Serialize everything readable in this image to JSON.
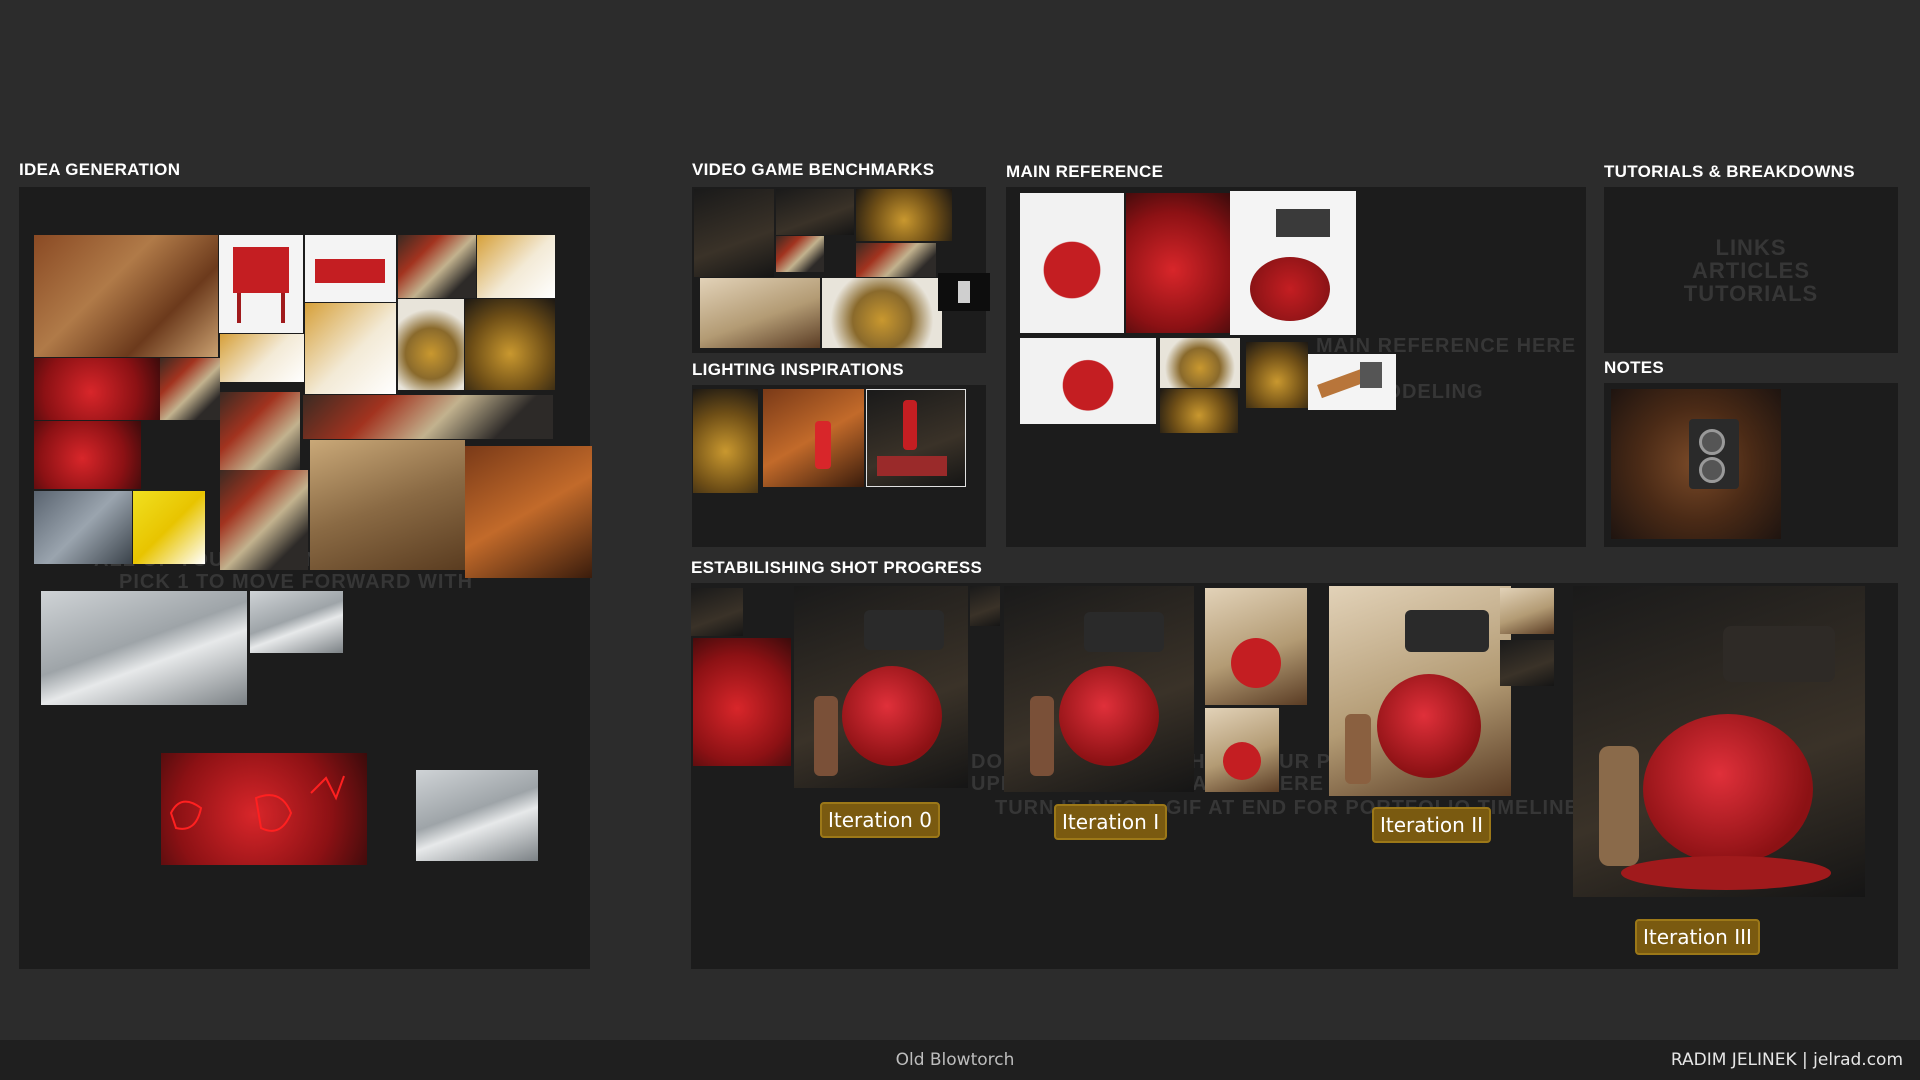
{
  "sections": {
    "idea_generation": "IDEA GENERATION",
    "video_game_benchmarks": "VIDEO GAME BENCHMARKS",
    "lighting_inspirations": "LIGHTING INSPIRATIONS",
    "main_reference": "MAIN REFERENCE",
    "tutorials_breakdowns": "TUTORIALS & BREAKDOWNS",
    "notes": "NOTES",
    "establishing_shot": "ESTABILISHING SHOT PROGRESS"
  },
  "tutorials_placeholder": {
    "line1": "LINKS",
    "line2": "ARTICLES",
    "line3": "TUTORIALS"
  },
  "iterations": [
    "Iteration 0",
    "Iteration I",
    "Iteration II",
    "Iteration III"
  ],
  "footer": {
    "title": "Old Blowtorch",
    "credit": "RADIM JELINEK | jelrad.com"
  },
  "colors": {
    "background": "#2c2c2c",
    "panel": "#1c1c1c",
    "tag": "#7a5a10",
    "footer": "#1f1f1f"
  }
}
